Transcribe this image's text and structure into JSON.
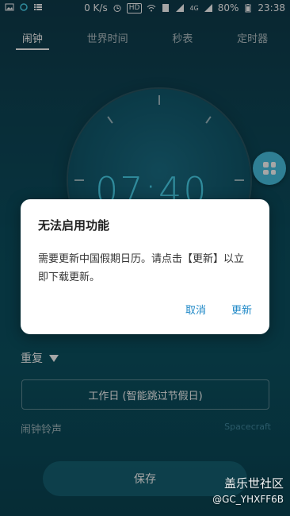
{
  "status_bar": {
    "speed": "0 K/s",
    "hd": "HD",
    "network": "4G",
    "battery": "80%",
    "time": "23:38"
  },
  "tabs": [
    {
      "label": "闹钟",
      "active": true
    },
    {
      "label": "世界时间",
      "active": false
    },
    {
      "label": "秒表",
      "active": false
    },
    {
      "label": "定时器",
      "active": false
    }
  ],
  "alarm": {
    "time": "07:40",
    "repeat_label": "重复",
    "workday_option": "工作日 (智能跳过节假日)",
    "ringtone_label": "闹钟铃声",
    "ringtone_value": "Spacecraft",
    "save_label": "保存"
  },
  "dialog": {
    "title": "无法启用功能",
    "body": "需要更新中国假期日历。请点击【更新】以立即下载更新。",
    "cancel_label": "取消",
    "update_label": "更新"
  },
  "watermark": {
    "site": "盖乐世社区",
    "user": "@GC_YHXFF6B"
  },
  "colors": {
    "accent": "#1e88c7",
    "time_color": "#4ad6f0",
    "fab": "#49c4e3"
  }
}
